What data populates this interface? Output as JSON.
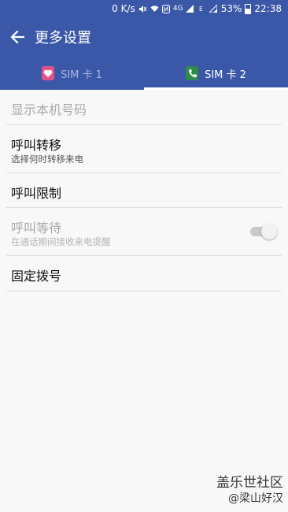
{
  "status_bar": {
    "net_speed": "0 K/s",
    "network_type": "4G",
    "battery": "53%",
    "time": "22:38",
    "icons": [
      "mute-icon",
      "wifi-icon",
      "nfc-icon",
      "4g-icon",
      "signal-icon",
      "sim2-e-icon",
      "signal2-icon",
      "battery-icon"
    ]
  },
  "app_bar": {
    "title": "更多设置",
    "back_icon": "arrow-left-icon"
  },
  "tabs": [
    {
      "label": "SIM 卡 1",
      "icon": "heart-sim-icon",
      "icon_color": "#e2538c",
      "selected": false
    },
    {
      "label": "SIM 卡 2",
      "icon": "phone-sim-icon",
      "icon_color": "#2e8b4a",
      "selected": true
    }
  ],
  "settings": [
    {
      "title": "显示本机号码",
      "enabled": false
    },
    {
      "title": "呼叫转移",
      "subtitle": "选择何时转移来电",
      "enabled": true
    },
    {
      "title": "呼叫限制",
      "enabled": true
    },
    {
      "title": "呼叫等待",
      "subtitle": "在通话期间接收来电提醒",
      "enabled": false,
      "toggle": "on"
    },
    {
      "title": "固定拨号",
      "enabled": true
    }
  ],
  "watermark": {
    "line1": "盖乐世社区",
    "line2": "@梁山好汉"
  },
  "colors": {
    "primary": "#3a57a8",
    "background": "#f8f8f8",
    "tab_inactive_text": "#aab6db"
  }
}
